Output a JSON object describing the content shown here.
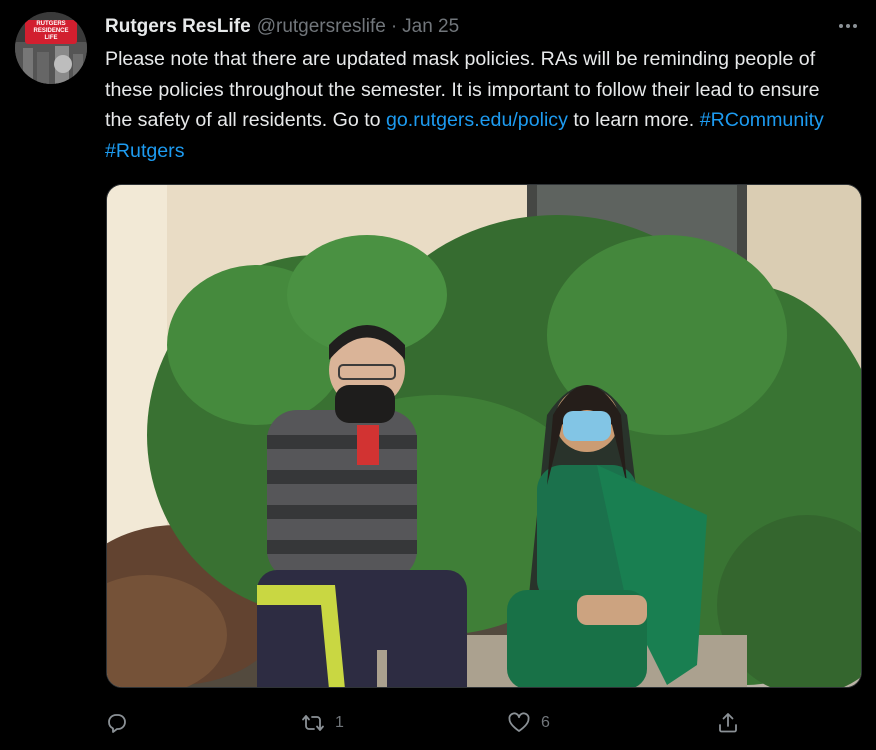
{
  "tweet": {
    "avatar": {
      "banner_lines": [
        "RUTGERS",
        "RESIDENCE",
        "LIFE"
      ]
    },
    "display_name": "Rutgers ResLife",
    "handle": "@rutgersreslife",
    "separator": "·",
    "date": "Jan 25",
    "text_main": "Please note that there are updated mask policies. RAs will be reminding people of these policies throughout the semester. It is important to follow their lead to ensure the safety of all residents. Go to ",
    "link": "go.rutgers.edu/policy",
    "text_after_link": " to learn more. ",
    "hashtags": [
      "#RCommunity",
      "#Rutgers"
    ],
    "actions": {
      "reply_count": "",
      "retweet_count": "1",
      "like_count": "6"
    }
  },
  "colors": {
    "background": "#000000",
    "text": "#e7e9ea",
    "secondary": "#71767b",
    "link": "#1d9bf0",
    "brand_red": "#d21f2f"
  },
  "icons": {
    "more": "more-horizontal-icon",
    "reply": "reply-icon",
    "retweet": "retweet-icon",
    "like": "heart-icon",
    "share": "share-icon"
  }
}
